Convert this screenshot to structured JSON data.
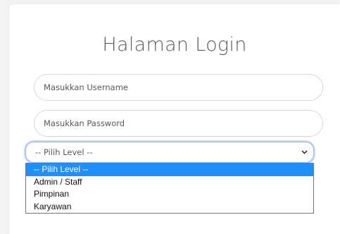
{
  "page": {
    "title": "Halaman Login"
  },
  "form": {
    "username_placeholder": "Masukkan Username",
    "password_placeholder": "Masukkan Password",
    "level_selected": "-- Pilih Level --",
    "level_options": [
      "-- Pilih Level --",
      "Admin / Staff",
      "Pimpinan",
      "Karyawan"
    ],
    "highlighted_option": 0
  },
  "colors": {
    "highlight": "#1e90ff",
    "focus_ring": "#c9d8fb",
    "title": "#5a5c69"
  },
  "icons": {
    "select_arrow": "chevron-down-icon"
  }
}
